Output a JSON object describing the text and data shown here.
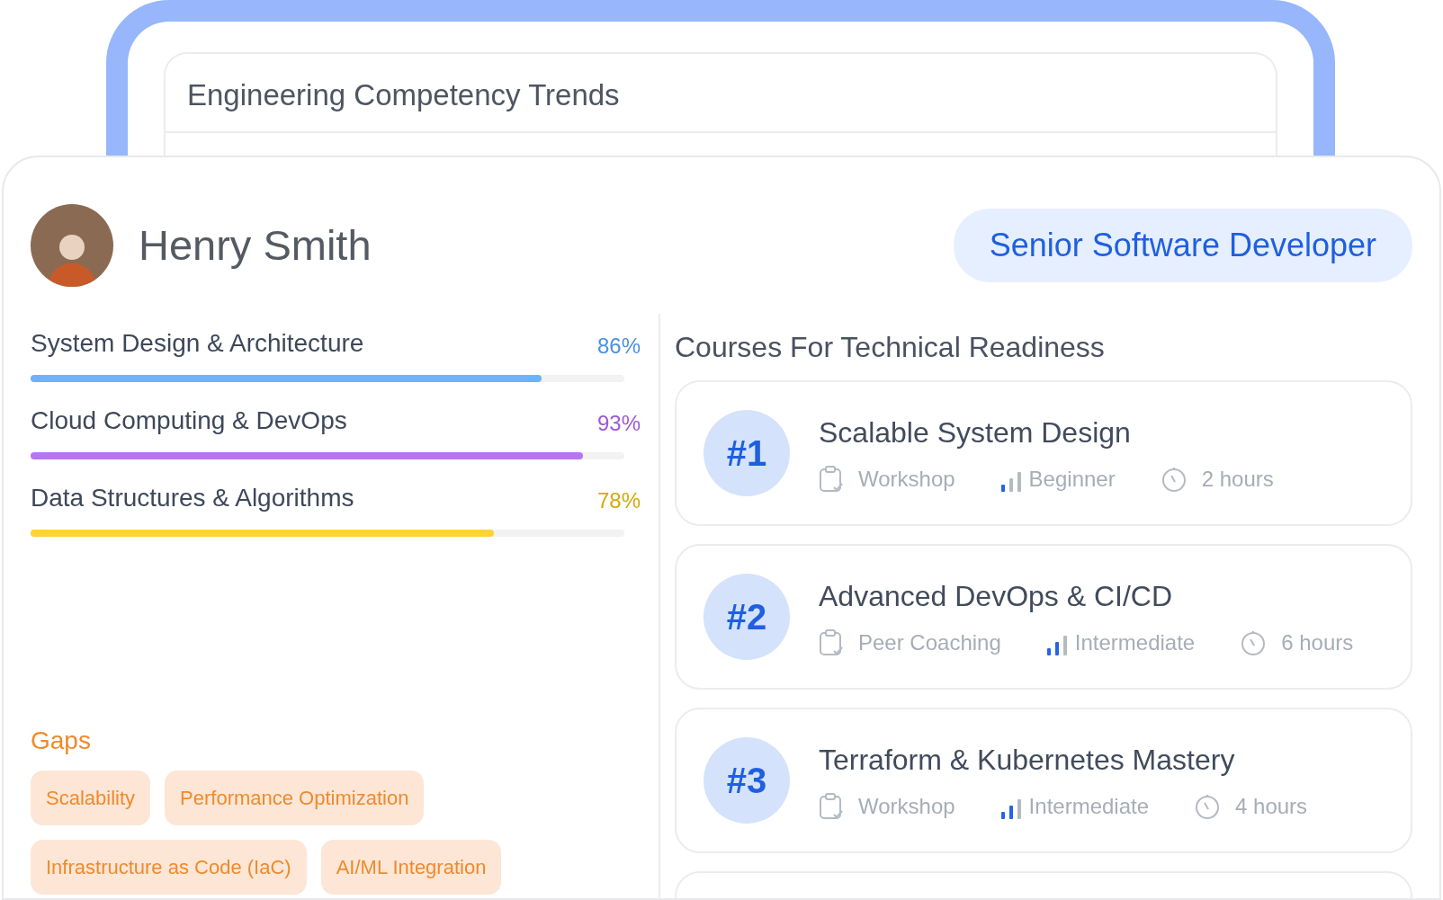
{
  "back_panel": {
    "title": "Engineering Competency Trends"
  },
  "profile": {
    "name": "Henry Smith",
    "role": "Senior Software Developer"
  },
  "skills": [
    {
      "name": "System Design & Architecture",
      "reading": "86%",
      "level": 0.86,
      "color": "#4a90e2"
    },
    {
      "name": "Cloud Computing & DevOps",
      "reading": "93%",
      "level": 0.93,
      "color": "#9b59d6"
    },
    {
      "name": "Data Structures & Algorithms",
      "reading": "78%",
      "level": 0.78,
      "color": "#d4a90a"
    }
  ],
  "gaps": {
    "title": "Gaps",
    "tags": [
      "Scalability",
      "Performance Optimization",
      "Infrastructure as Code (IaC)",
      "AI/ML Integration"
    ]
  },
  "courses": {
    "title": "Courses For Technical Readiness",
    "items": [
      {
        "rank": "#1",
        "title": "Scalable System Design",
        "format": "Workshop",
        "difficulty": "Beginner",
        "level": 0.33,
        "duration": "2 hours"
      },
      {
        "rank": "#2",
        "title": "Advanced DevOps & CI/CD",
        "format": "Peer Coaching",
        "difficulty": "Intermediate",
        "level": 0.67,
        "duration": "6 hours"
      },
      {
        "rank": "#3",
        "title": "Terraform & Kubernetes Mastery",
        "format": "Workshop",
        "difficulty": "Intermediate",
        "level": 0.67,
        "duration": "4 hours"
      }
    ]
  }
}
